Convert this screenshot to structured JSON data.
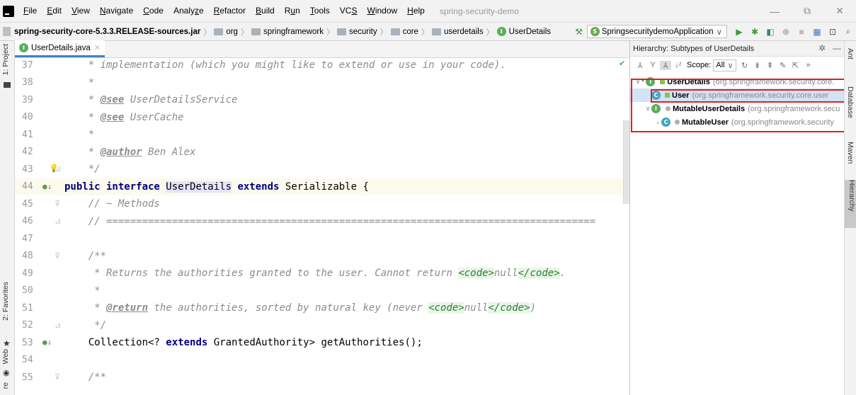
{
  "menu": {
    "items": [
      {
        "pre": "",
        "ul": "F",
        "post": "ile"
      },
      {
        "pre": "",
        "ul": "E",
        "post": "dit"
      },
      {
        "pre": "",
        "ul": "V",
        "post": "iew"
      },
      {
        "pre": "",
        "ul": "N",
        "post": "avigate"
      },
      {
        "pre": "",
        "ul": "C",
        "post": "ode"
      },
      {
        "pre": "Analy",
        "ul": "z",
        "post": "e"
      },
      {
        "pre": "",
        "ul": "R",
        "post": "efactor"
      },
      {
        "pre": "",
        "ul": "B",
        "post": "uild"
      },
      {
        "pre": "R",
        "ul": "u",
        "post": "n"
      },
      {
        "pre": "",
        "ul": "T",
        "post": "ools"
      },
      {
        "pre": "VC",
        "ul": "S",
        "post": ""
      },
      {
        "pre": "",
        "ul": "W",
        "post": "indow"
      },
      {
        "pre": "",
        "ul": "H",
        "post": "elp"
      }
    ],
    "project_title": "spring-security-demo"
  },
  "window_controls": {
    "minimize": "—",
    "restore": "⧉",
    "close": "✕"
  },
  "breadcrumb": {
    "jar": "spring-security-core-5.3.3.RELEASE-sources.jar",
    "folders": [
      "org",
      "springframework",
      "security",
      "core",
      "userdetails"
    ],
    "file": "UserDetails"
  },
  "run_config": {
    "label": "SpringsecuritydemoApplication"
  },
  "left_tabs": {
    "project": "1: Project",
    "favorites": "2: Favorites",
    "web": "Web",
    "structure": "re"
  },
  "editor": {
    "tab_label": "UserDetails.java",
    "lines": [
      {
        "num": "37",
        "segments": [
          {
            "t": "    ",
            "c": "code"
          },
          {
            "t": "* implementation (which you might like to extend or use in your code).",
            "c": "cm"
          }
        ]
      },
      {
        "num": "38",
        "segments": [
          {
            "t": "    ",
            "c": "code"
          },
          {
            "t": "*",
            "c": "cm"
          }
        ]
      },
      {
        "num": "39",
        "segments": [
          {
            "t": "    ",
            "c": "code"
          },
          {
            "t": "* ",
            "c": "cm"
          },
          {
            "t": "@see",
            "c": "tag"
          },
          {
            "t": " UserDetailsService",
            "c": "cm"
          }
        ]
      },
      {
        "num": "40",
        "segments": [
          {
            "t": "    ",
            "c": "code"
          },
          {
            "t": "* ",
            "c": "cm"
          },
          {
            "t": "@see",
            "c": "tag"
          },
          {
            "t": " UserCache",
            "c": "cm"
          }
        ]
      },
      {
        "num": "41",
        "segments": [
          {
            "t": "    ",
            "c": "code"
          },
          {
            "t": "*",
            "c": "cm"
          }
        ]
      },
      {
        "num": "42",
        "segments": [
          {
            "t": "    ",
            "c": "code"
          },
          {
            "t": "* ",
            "c": "cm"
          },
          {
            "t": "@author",
            "c": "tag"
          },
          {
            "t": " Ben Alex",
            "c": "cm"
          }
        ]
      },
      {
        "num": "43",
        "segments": [
          {
            "t": "    ",
            "c": "code"
          },
          {
            "t": "*/",
            "c": "cm"
          }
        ]
      },
      {
        "num": "44",
        "segments": [
          {
            "t": "public interface ",
            "c": "kw"
          },
          {
            "t": "UserDetails",
            "c": "hl"
          },
          {
            "t": " ",
            "c": "code"
          },
          {
            "t": "extends",
            "c": "kw"
          },
          {
            "t": " Serializable {",
            "c": "code"
          }
        ]
      },
      {
        "num": "45",
        "segments": [
          {
            "t": "    ",
            "c": "code"
          },
          {
            "t": "// ~ Methods",
            "c": "cm"
          }
        ]
      },
      {
        "num": "46",
        "segments": [
          {
            "t": "    ",
            "c": "code"
          },
          {
            "t": "// ==================================================================================",
            "c": "cm"
          }
        ]
      },
      {
        "num": "47",
        "segments": [
          {
            "t": "",
            "c": "code"
          }
        ]
      },
      {
        "num": "48",
        "segments": [
          {
            "t": "    ",
            "c": "code"
          },
          {
            "t": "/**",
            "c": "cm"
          }
        ]
      },
      {
        "num": "49",
        "segments": [
          {
            "t": "     ",
            "c": "code"
          },
          {
            "t": "* Returns the authorities granted to the user. Cannot return ",
            "c": "cm"
          },
          {
            "t": "<code>",
            "c": "html-tag"
          },
          {
            "t": "null",
            "c": "cm"
          },
          {
            "t": "</code>",
            "c": "html-tag"
          },
          {
            "t": ".",
            "c": "cm"
          }
        ]
      },
      {
        "num": "50",
        "segments": [
          {
            "t": "     ",
            "c": "code"
          },
          {
            "t": "*",
            "c": "cm"
          }
        ]
      },
      {
        "num": "51",
        "segments": [
          {
            "t": "     ",
            "c": "code"
          },
          {
            "t": "* ",
            "c": "cm"
          },
          {
            "t": "@return",
            "c": "tag"
          },
          {
            "t": " the authorities, sorted by natural key (never ",
            "c": "cm"
          },
          {
            "t": "<code>",
            "c": "html-tag"
          },
          {
            "t": "null",
            "c": "cm"
          },
          {
            "t": "</code>",
            "c": "html-tag"
          },
          {
            "t": ")",
            "c": "cm"
          }
        ]
      },
      {
        "num": "52",
        "segments": [
          {
            "t": "     ",
            "c": "code"
          },
          {
            "t": "*/",
            "c": "cm"
          }
        ]
      },
      {
        "num": "53",
        "segments": [
          {
            "t": "    Collection<? ",
            "c": "code"
          },
          {
            "t": "extends",
            "c": "kw"
          },
          {
            "t": " GrantedAuthority> getAuthorities();",
            "c": "code"
          }
        ]
      },
      {
        "num": "54",
        "segments": [
          {
            "t": "",
            "c": "code"
          }
        ]
      },
      {
        "num": "55",
        "segments": [
          {
            "t": "    ",
            "c": "code"
          },
          {
            "t": "/**",
            "c": "cm"
          }
        ]
      }
    ]
  },
  "hierarchy": {
    "title": "Hierarchy: Subtypes of UserDetails",
    "scope_label": "Scope:",
    "scope_value": "All",
    "tree": [
      {
        "name": "UserDetails",
        "pkg": "(org.springframework.security.core.",
        "icon": "I",
        "arrow": "∨",
        "prefix": "*",
        "indent": 0
      },
      {
        "name": "User",
        "pkg": "(org.springframework.security.core.user",
        "icon": "C",
        "arrow": "",
        "prefix": "",
        "indent": 1
      },
      {
        "name": "MutableUserDetails",
        "pkg": "(org.springframework.secu",
        "icon": "I",
        "arrow": "∨",
        "prefix": "",
        "indent": 1
      },
      {
        "name": "MutableUser",
        "pkg": "(org.springframework.security",
        "icon": "C",
        "arrow": "›",
        "prefix": "",
        "indent": 2
      }
    ]
  },
  "right_tabs": {
    "ant": "Ant",
    "database": "Database",
    "maven": "Maven",
    "hierarchy": "Hierarchy"
  },
  "colors": {
    "highlight_box": "#e02020",
    "selection": "#d4e2f5",
    "current_line": "#fcfaed",
    "accent_tab": "#4083c9"
  }
}
